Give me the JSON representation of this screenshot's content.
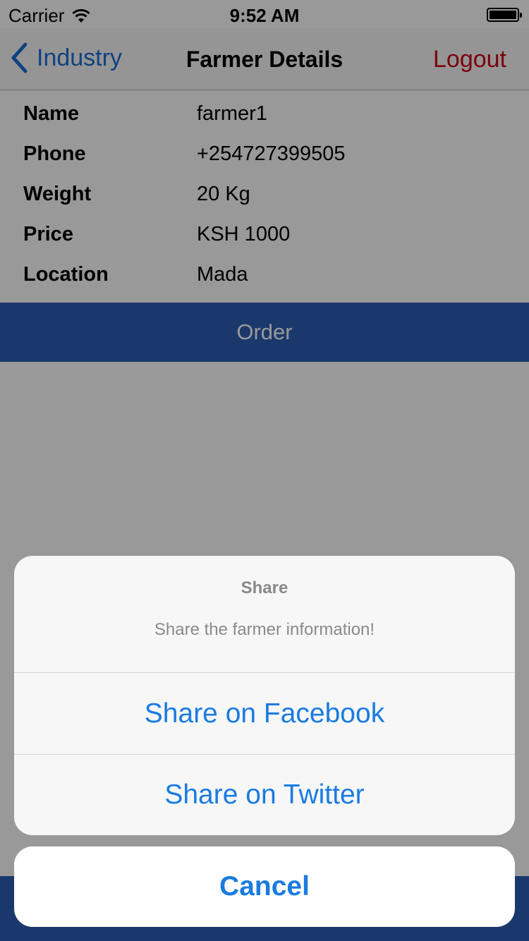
{
  "status_bar": {
    "carrier": "Carrier",
    "time": "9:52 AM"
  },
  "nav": {
    "back_label": "Industry",
    "title": "Farmer Details",
    "logout_label": "Logout"
  },
  "details": [
    {
      "label": "Name",
      "value": "farmer1"
    },
    {
      "label": "Phone",
      "value": "+254727399505"
    },
    {
      "label": "Weight",
      "value": "20 Kg"
    },
    {
      "label": "Price",
      "value": "KSH 1000"
    },
    {
      "label": "Location",
      "value": "Mada"
    }
  ],
  "order_label": "Order",
  "action_sheet": {
    "title": "Share",
    "message": "Share the farmer information!",
    "actions": [
      "Share on Facebook",
      "Share on Twitter"
    ],
    "cancel_label": "Cancel"
  },
  "colors": {
    "accent_blue": "#1a7be0",
    "logout_red": "#d0021b",
    "order_bar": "#2d5eb4"
  },
  "icons": [
    "wifi-icon",
    "battery-icon",
    "back-chevron-icon"
  ]
}
